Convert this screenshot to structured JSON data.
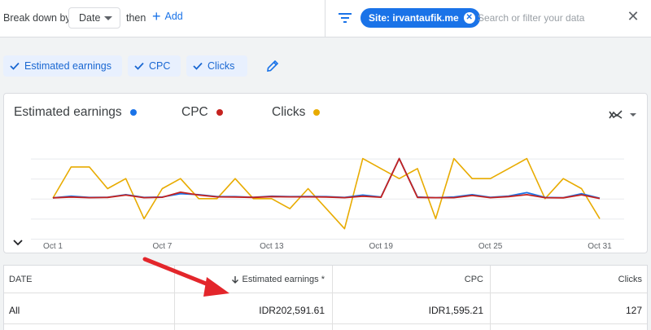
{
  "topbar": {
    "breakdown_label": "Break down by",
    "date_value": "Date",
    "then_label": "then",
    "add_label": "Add",
    "site_chip": "Site: irvantaufik.me",
    "search_placeholder": "Search or filter your data"
  },
  "metrics": [
    {
      "label": "Estimated earnings"
    },
    {
      "label": "CPC"
    },
    {
      "label": "Clicks"
    }
  ],
  "colors": {
    "earnings": "#1a73e8",
    "cpc": "#c5221f",
    "clicks": "#e8ab00",
    "accent": "#1a73e8"
  },
  "chart_data": {
    "type": "line",
    "x": [
      "Oct 1",
      "Oct 2",
      "Oct 3",
      "Oct 4",
      "Oct 5",
      "Oct 6",
      "Oct 7",
      "Oct 8",
      "Oct 9",
      "Oct 10",
      "Oct 11",
      "Oct 12",
      "Oct 13",
      "Oct 14",
      "Oct 15",
      "Oct 16",
      "Oct 17",
      "Oct 18",
      "Oct 19",
      "Oct 20",
      "Oct 21",
      "Oct 22",
      "Oct 23",
      "Oct 24",
      "Oct 25",
      "Oct 26",
      "Oct 27",
      "Oct 28",
      "Oct 29",
      "Oct 30",
      "Oct 31"
    ],
    "x_tick_labels": [
      "Oct 1",
      "Oct 7",
      "Oct 13",
      "Oct 19",
      "Oct 25",
      "Oct 31"
    ],
    "series": [
      {
        "name": "Estimated earnings",
        "values": [
          0.4,
          1.2,
          0.6,
          0.7,
          2.0,
          0.6,
          0.8,
          2.5,
          2.0,
          1.0,
          1.0,
          0.7,
          1.2,
          1.0,
          1.1,
          1.0,
          0.6,
          1.8,
          0.8,
          20.0,
          0.8,
          0.5,
          0.8,
          2.0,
          0.7,
          1.3,
          3.0,
          0.6,
          0.5,
          2.5,
          0.2
        ]
      },
      {
        "name": "CPC",
        "values": [
          0.4,
          0.8,
          0.5,
          0.6,
          1.8,
          0.5,
          0.7,
          3.2,
          1.8,
          0.9,
          0.8,
          0.6,
          1.0,
          0.9,
          0.9,
          0.8,
          0.5,
          1.2,
          0.7,
          20.0,
          0.6,
          0.5,
          0.5,
          1.6,
          0.5,
          1.0,
          2.0,
          0.5,
          0.4,
          1.9,
          0.1
        ]
      },
      {
        "name": "Clicks",
        "values": [
          0.3,
          15.8,
          15.8,
          5.0,
          10.0,
          -10.0,
          5.0,
          10.0,
          0.0,
          0.0,
          10.0,
          0.0,
          0.0,
          -5.0,
          5.0,
          -5.0,
          -15.0,
          20.0,
          15.0,
          10.0,
          15.0,
          -10.0,
          20.0,
          10.0,
          10.0,
          15.0,
          20.0,
          0.0,
          10.0,
          5.0,
          -10.0
        ]
      }
    ],
    "grid": true,
    "ylim": [
      -20,
      30
    ],
    "legend": "top-left"
  },
  "table": {
    "headers": {
      "date": "DATE",
      "earnings": "Estimated earnings *",
      "cpc": "CPC",
      "clicks": "Clicks"
    },
    "rows": [
      {
        "date": "All",
        "earnings": "IDR202,591.61",
        "cpc": "IDR1,595.21",
        "clicks": "127"
      }
    ]
  },
  "icons": {
    "filter": "filter-icon",
    "close": "close-icon",
    "edit": "edit-icon",
    "chart_type": "chart-type-icon",
    "collapse": "chevron-down-icon",
    "sort": "arrow-down-icon",
    "check": "check-icon"
  }
}
